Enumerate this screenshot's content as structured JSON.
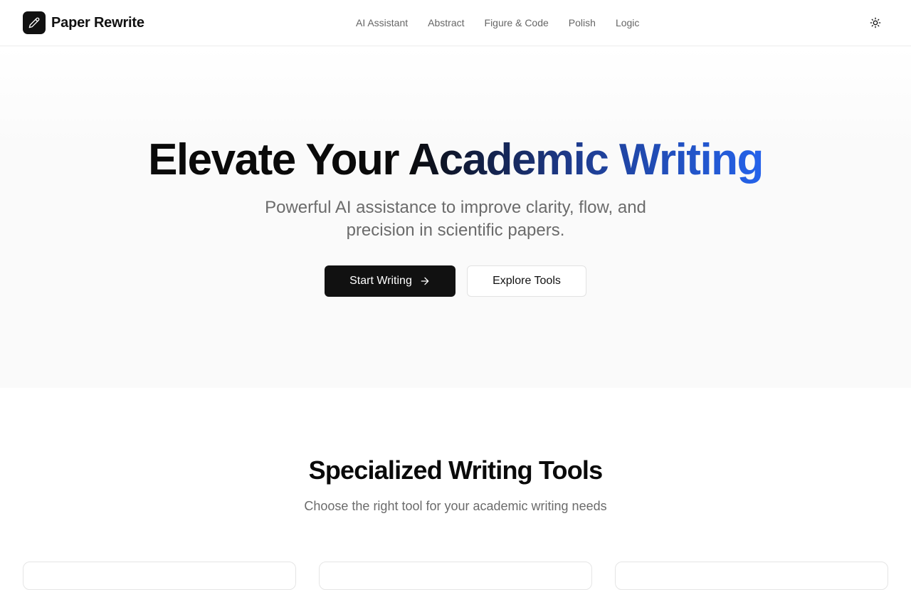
{
  "brand": {
    "name": "Paper Rewrite",
    "logo_icon": "pencil-icon"
  },
  "nav": {
    "items": [
      {
        "label": "AI Assistant"
      },
      {
        "label": "Abstract"
      },
      {
        "label": "Figure & Code"
      },
      {
        "label": "Polish"
      },
      {
        "label": "Logic"
      }
    ],
    "theme_icon": "sun-icon"
  },
  "hero": {
    "title_part1": "Elevate Your ",
    "title_part2": "Academic Writing",
    "subtitle": "Powerful AI assistance to improve clarity, flow, and precision in scientific papers.",
    "primary_button": "Start Writing",
    "secondary_button": "Explore Tools"
  },
  "tools_section": {
    "title": "Specialized Writing Tools",
    "subtitle": "Choose the right tool for your academic writing needs"
  },
  "colors": {
    "primary": "#111111",
    "accent_blue": "#2563eb",
    "muted_text": "#6b6b6b"
  }
}
